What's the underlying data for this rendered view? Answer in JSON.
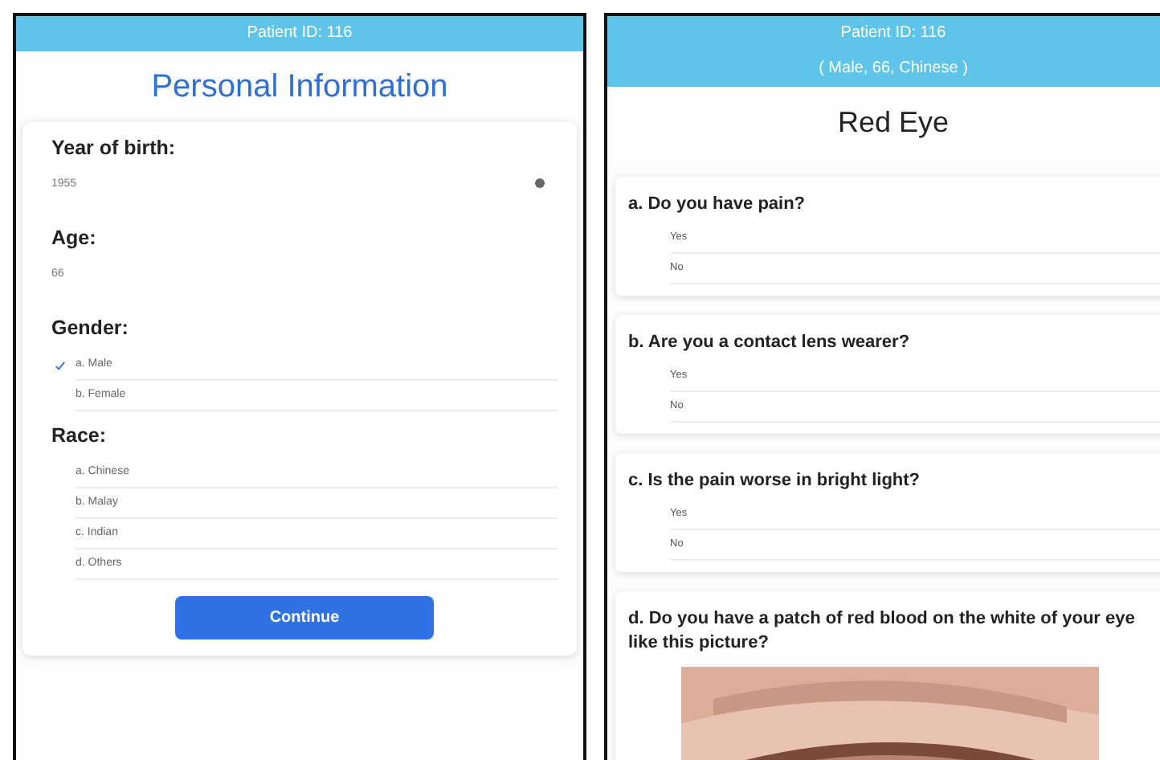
{
  "patient_form": {
    "header": "Patient ID: 116",
    "title": "Personal Information",
    "fields": [
      {
        "kind": "picker",
        "label": "Year of birth:",
        "value": "1955"
      },
      {
        "kind": "value",
        "label": "Age:",
        "value": "66"
      },
      {
        "kind": "choice",
        "label": "Gender:",
        "options": [
          {
            "label": "a. Male",
            "selected": true
          },
          {
            "label": "b. Female",
            "selected": false
          }
        ]
      },
      {
        "kind": "choice",
        "label": "Race:",
        "options": [
          {
            "label": "a. Chinese",
            "selected": false
          },
          {
            "label": "b. Malay",
            "selected": false
          },
          {
            "label": "c. Indian",
            "selected": false
          },
          {
            "label": "d. Others",
            "selected": false
          }
        ]
      }
    ],
    "button": "Continue"
  },
  "questionnaire": {
    "header": "Patient ID: 116",
    "subheader": "( Male, 66, Chinese )",
    "title": "Red Eye",
    "questions": [
      {
        "kind": "choice",
        "text": "a. Do you have pain?",
        "options": [
          {
            "label": "Yes",
            "selected": false
          },
          {
            "label": "No",
            "selected": false
          }
        ]
      },
      {
        "kind": "choice",
        "text": "b. Are you a contact lens wearer?",
        "options": [
          {
            "label": "Yes",
            "selected": false
          },
          {
            "label": "No",
            "selected": false
          }
        ]
      },
      {
        "kind": "choice",
        "text": "c. Is the pain worse in bright light?",
        "options": [
          {
            "label": "Yes",
            "selected": false
          },
          {
            "label": "No",
            "selected": false
          }
        ]
      },
      {
        "kind": "picture",
        "text": "d. Do you have a patch of red blood on the white of your eye like this picture?"
      }
    ]
  }
}
